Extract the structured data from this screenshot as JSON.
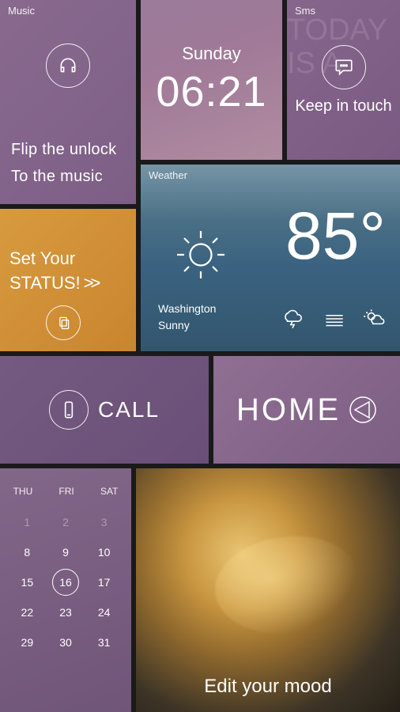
{
  "music": {
    "label": "Music",
    "line1": "Flip the unlock",
    "line2": "To the music"
  },
  "clock": {
    "day": "Sunday",
    "time": "06:21"
  },
  "sms": {
    "label": "Sms",
    "text": "Keep in touch",
    "bg": "TODAY IS A"
  },
  "status": {
    "line1": "Set Your",
    "line2": "STATUS!",
    "arrows": ">>"
  },
  "weather": {
    "label": "Weather",
    "temp": "85°",
    "city": "Washington",
    "condition": "Sunny"
  },
  "call": {
    "text": "CALL"
  },
  "home": {
    "text": "HOME"
  },
  "calendar": {
    "headers": [
      "THU",
      "FRI",
      "SAT"
    ],
    "cells": [
      "1",
      "2",
      "3",
      "8",
      "9",
      "10",
      "15",
      "16",
      "17",
      "22",
      "23",
      "24",
      "29",
      "30",
      "31"
    ],
    "today": "16"
  },
  "mood": {
    "text": "Edit your mood"
  }
}
